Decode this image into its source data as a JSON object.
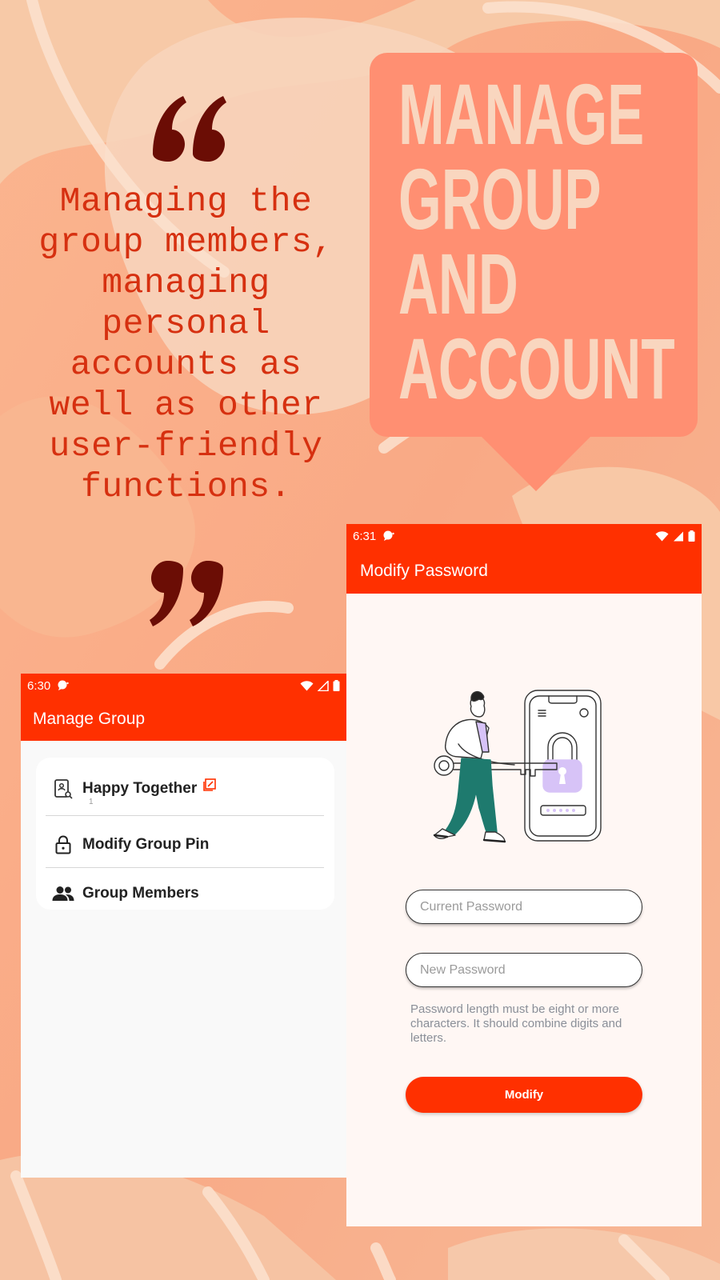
{
  "promo": {
    "quote": "Managing the group members, managing personal accounts as well as other user-friendly functions.",
    "headline_lines": [
      "MANAGE",
      "GROUP",
      "AND",
      "ACCOUNT"
    ]
  },
  "manage_group_screen": {
    "status_time": "6:30",
    "title": "Manage Group",
    "group_name": "Happy Together",
    "group_count": "1",
    "items": [
      {
        "label": "Modify Group Pin",
        "icon": "lock-icon"
      },
      {
        "label": "Group Members",
        "icon": "people-icon"
      }
    ]
  },
  "modify_password_screen": {
    "status_time": "6:31",
    "title": "Modify Password",
    "current_password_placeholder": "Current Password",
    "new_password_placeholder": "New Password",
    "hint": "Password length must be eight or more characters. It should combine digits and letters.",
    "button_label": "Modify"
  },
  "colors": {
    "accent": "#ff3000",
    "bubble": "#ff8f72",
    "quote_text": "#d63010",
    "quote_marks": "#6b0d05",
    "headline": "#f9d6bf"
  }
}
